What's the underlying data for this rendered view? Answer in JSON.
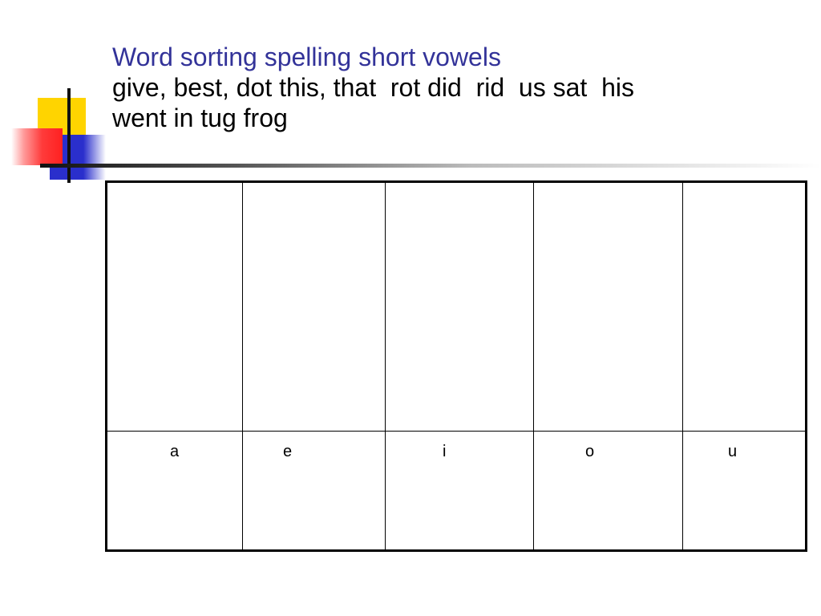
{
  "slide": {
    "title": "Word sorting spelling short vowels",
    "word_list": "give, best, dot this, that  rot did  rid  us sat  his\nwent in tug frog"
  },
  "table": {
    "vowels": [
      "a",
      "e",
      "i",
      "o",
      "u"
    ]
  },
  "colors": {
    "title": "#333399",
    "accent_yellow": "#ffd400",
    "accent_blue": "#2a2fcc",
    "accent_red": "#ff2020"
  }
}
